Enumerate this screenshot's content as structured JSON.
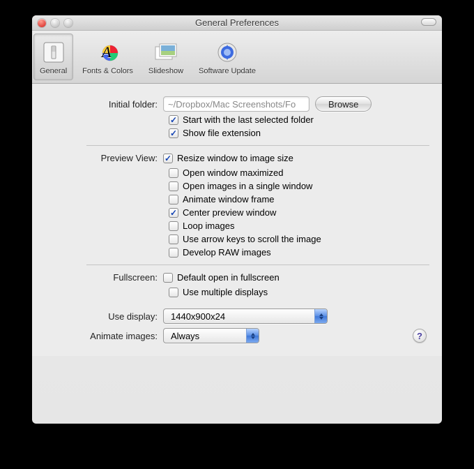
{
  "window": {
    "title": "General Preferences"
  },
  "toolbar": {
    "items": [
      {
        "label": "General"
      },
      {
        "label": "Fonts & Colors"
      },
      {
        "label": "Slideshow"
      },
      {
        "label": "Software Update"
      }
    ]
  },
  "initial_folder": {
    "label": "Initial folder:",
    "value": "~/Dropbox/Mac Screenshots/Fo",
    "browse": "Browse",
    "start_with_last": "Start with the last selected folder",
    "show_ext": "Show file extension"
  },
  "preview": {
    "label": "Preview View:",
    "resize": "Resize window to image size",
    "open_max": "Open window maximized",
    "single_window": "Open images in a single window",
    "animate_frame": "Animate window frame",
    "center": "Center preview window",
    "loop": "Loop images",
    "arrow_scroll": "Use arrow keys to scroll the image",
    "develop_raw": "Develop RAW images"
  },
  "fullscreen": {
    "label": "Fullscreen:",
    "default_open": "Default open in fullscreen",
    "multiple": "Use multiple displays"
  },
  "use_display": {
    "label": "Use display:",
    "value": "1440x900x24"
  },
  "animate_images": {
    "label": "Animate images:",
    "value": "Always"
  },
  "help": "?"
}
